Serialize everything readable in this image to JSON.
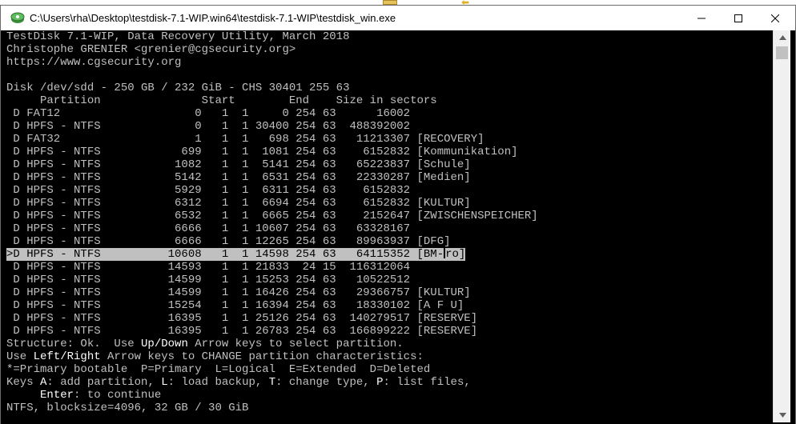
{
  "window": {
    "title": "C:\\Users\\rha\\Desktop\\testdisk-7.1-WIP.win64\\testdisk-7.1-WIP\\testdisk_win.exe"
  },
  "colors": {
    "console_bg": "#000000",
    "console_text": "#c0c0c0",
    "highlight_bg": "#c0c0c0",
    "highlight_text": "#000000"
  },
  "icons": {
    "app": "testdisk-app-icon",
    "minimize": "minimize-icon",
    "maximize": "maximize-icon",
    "close": "close-icon",
    "scroll_up": "scroll-up-arrow-icon",
    "scroll_down": "scroll-down-arrow-icon"
  },
  "console": {
    "header": [
      "TestDisk 7.1-WIP, Data Recovery Utility, March 2018",
      "Christophe GRENIER <grenier@cgsecurity.org>",
      "https://www.cgsecurity.org",
      ""
    ],
    "disk_info": "Disk /dev/sdd - 250 GB / 232 GiB - CHS 30401 255 63",
    "column_header": "     Partition               Start        End    Size in sectors",
    "partitions": [
      " D FAT12                    0   1  1     0 254 63      16002",
      " D HPFS - NTFS              0   1  1 30400 254 63  488392002",
      " D FAT32                    1   1  1   698 254 63   11213307 [RECOVERY]",
      " D HPFS - NTFS            699   1  1  1081 254 63    6152832 [Kommunikation]",
      " D HPFS - NTFS           1082   1  1  5141 254 63   65223837 [Schule]",
      " D HPFS - NTFS           5142   1  1  6531 254 63   22330287 [Medien]",
      " D HPFS - NTFS           5929   1  1  6311 254 63    6152832",
      " D HPFS - NTFS           6312   1  1  6694 254 63    6152832 [KULTUR]",
      " D HPFS - NTFS           6532   1  1  6665 254 63    2152647 [ZWISCHENSPEICHER]",
      " D HPFS - NTFS           6666   1  1 10607 254 63   63328167",
      " D HPFS - NTFS           6666   1  1 12265 254 63   89963937 [DFG]",
      ">D HPFS - NTFS          10608   1  1 14598 254 63   64115352 [BM-",
      " D HPFS - NTFS          14593   1  1 21833  24 15  116312064",
      " D HPFS - NTFS          14599   1  1 15253 254 63   10522512",
      " D HPFS - NTFS          14599   1  1 16426 254 63   29366757 [KULTUR]",
      " D HPFS - NTFS          15254   1  1 16394 254 63   18330102 [A F U]",
      " D HPFS - NTFS          16395   1  1 25126 254 63  140279517 [RESERVE]",
      " D HPFS - NTFS          16395   1  1 26783 254 63  166899222 [RESERVE]"
    ],
    "selected_tail": "ro]",
    "structure": {
      "prefix": "Structure: Ok.  Use ",
      "key": "Up/Down",
      "suffix": " Arrow keys to select partition."
    },
    "left_right": {
      "prefix": "Use ",
      "key": "Left/Right",
      "suffix": " Arrow keys to CHANGE partition characteristics:"
    },
    "legend": "*=Primary bootable  P=Primary  L=Logical  E=Extended  D=Deleted",
    "keys": {
      "prefix": "Keys ",
      "k1": "A",
      "t1": ": add partition, ",
      "k2": "L",
      "t2": ": load backup, ",
      "k3": "T",
      "t3": ": change type, ",
      "k4": "P",
      "t4": ": list files,"
    },
    "enter": {
      "indent": "     ",
      "key": "Enter",
      "suffix": ": to continue"
    },
    "status": "NTFS, blocksize=4096, 32 GB / 30 GiB"
  }
}
